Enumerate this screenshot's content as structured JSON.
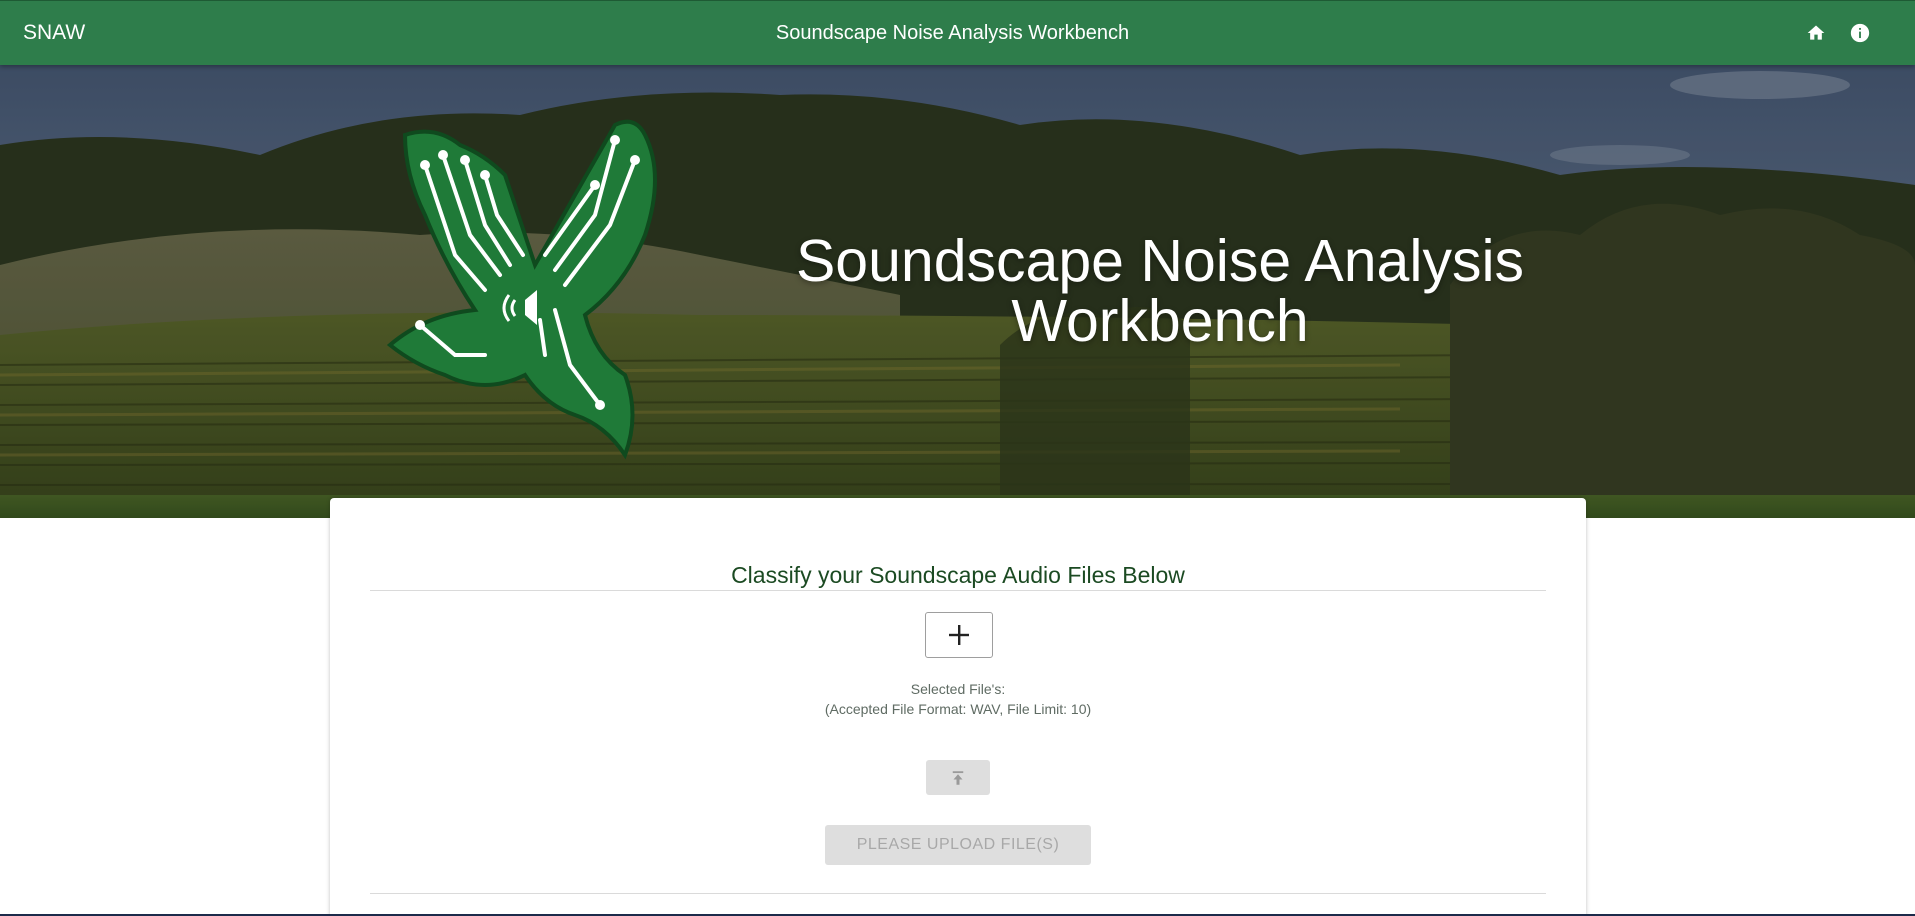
{
  "appbar": {
    "brand": "SNAW",
    "title": "Soundscape Noise Analysis Workbench",
    "icons": [
      "home-icon",
      "info-icon"
    ]
  },
  "hero": {
    "title": "Soundscape Noise Analysis Workbench",
    "logo": "circuit-bird-logo"
  },
  "card": {
    "heading": "Classify your Soundscape Audio Files Below",
    "add_icon": "plus-icon",
    "selected_label": "Selected File's:",
    "format_label": "(Accepted File Format: WAV, File Limit: 10)",
    "upload_icon": "upload-icon",
    "upload_button_label": "PLEASE UPLOAD FILE(S)"
  },
  "colors": {
    "appbar": "#2e7d4b",
    "heading": "#1b4a22",
    "disabled_button": "#dedede"
  }
}
